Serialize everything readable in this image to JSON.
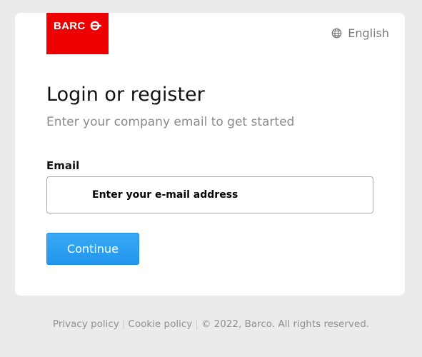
{
  "brand": {
    "logo_text": "BARCO",
    "logo_color": "#ec0000"
  },
  "language": {
    "label": "English",
    "icon": "globe-icon"
  },
  "login": {
    "title": "Login or register",
    "subtitle": "Enter your company email to get started",
    "email_label": "Email",
    "email_placeholder": "Enter your e-mail address",
    "email_value": "",
    "continue_label": "Continue",
    "accent_color": "#2a9af0"
  },
  "footer": {
    "privacy_link": "Privacy policy",
    "cookie_link": "Cookie policy",
    "separator": "|",
    "copyright": "© 2022, Barco. All rights reserved."
  }
}
